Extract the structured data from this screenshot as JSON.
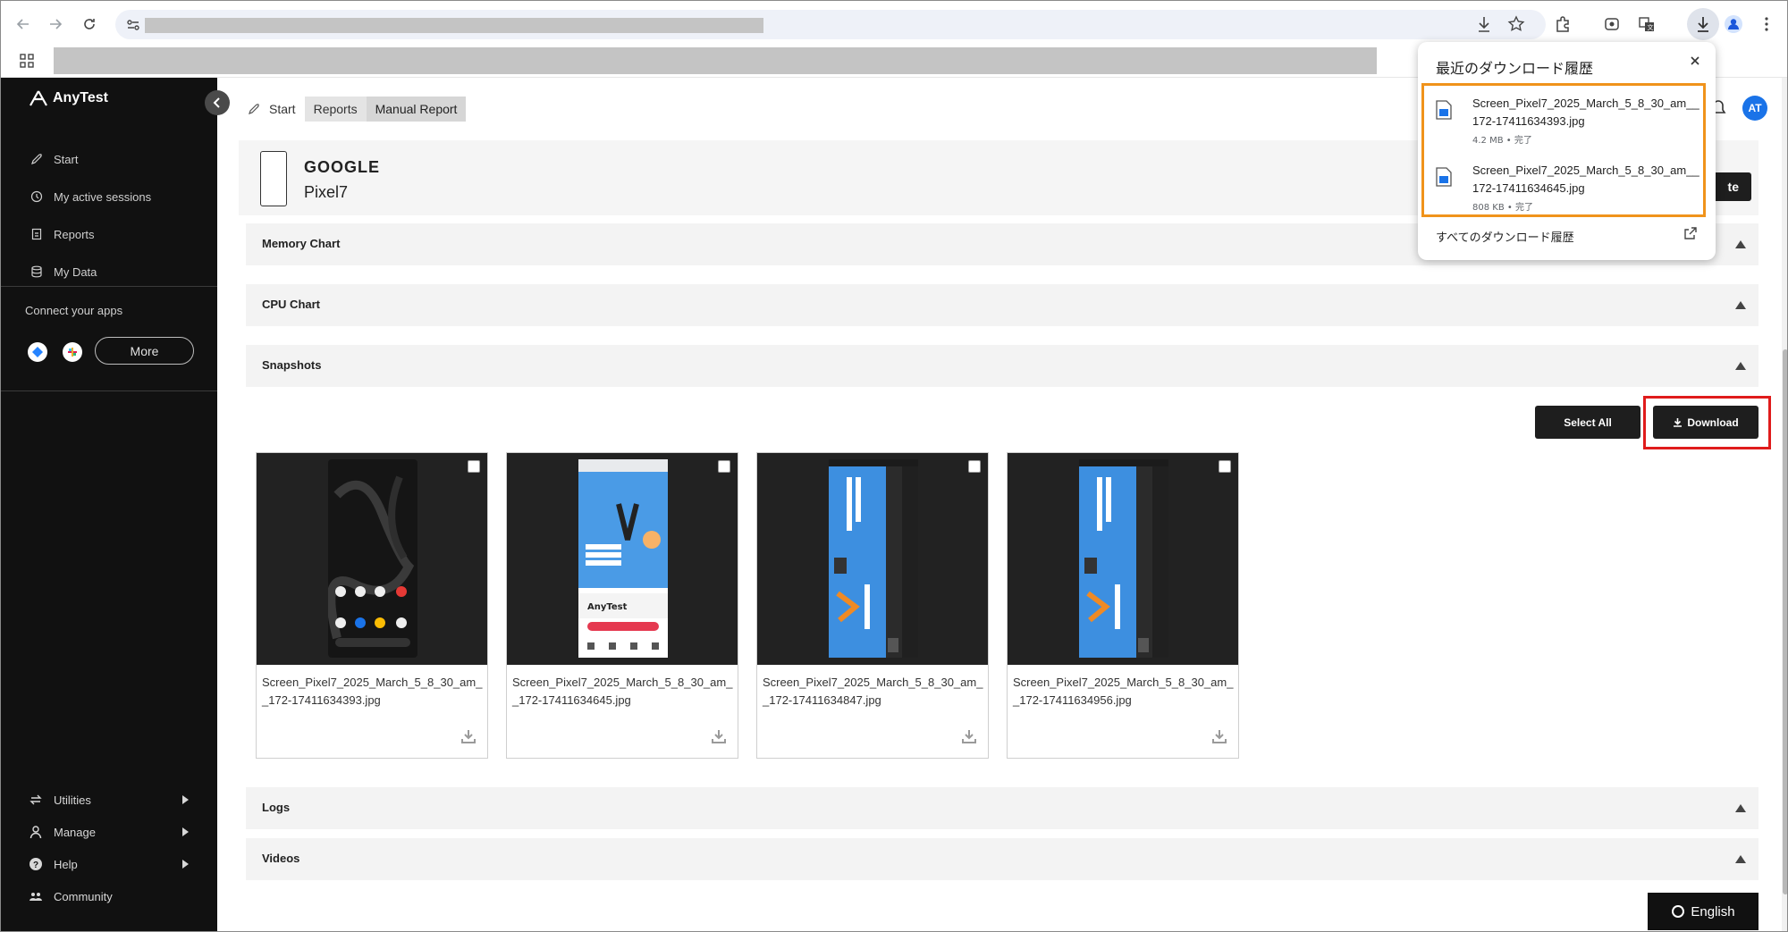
{
  "browser": {
    "icons": [
      "back-icon",
      "forward-icon",
      "reload-icon",
      "site-settings-icon",
      "download-icon",
      "star-icon",
      "extensions-icon",
      "screenshot-icon",
      "translate-icon",
      "downloads-icon",
      "profile-icon",
      "more-icon",
      "apps-icon"
    ]
  },
  "sidebar": {
    "brand": "AnyTest",
    "nav": [
      {
        "label": "Start",
        "icon": "rocket-icon"
      },
      {
        "label": "My active sessions",
        "icon": "clock-icon"
      },
      {
        "label": "Reports",
        "icon": "report-icon"
      },
      {
        "label": "My Data",
        "icon": "database-icon"
      }
    ],
    "connect_label": "Connect your apps",
    "more_label": "More",
    "bottom": [
      {
        "label": "Utilities",
        "icon": "utilities-icon"
      },
      {
        "label": "Manage",
        "icon": "person-icon"
      },
      {
        "label": "Help",
        "icon": "help-icon"
      },
      {
        "label": "Community",
        "icon": "community-icon"
      }
    ]
  },
  "breadcrumb": [
    "Start",
    "Reports",
    "Manual Report"
  ],
  "user": {
    "initials": "AT"
  },
  "device": {
    "brand": "GOOGLE",
    "model": "Pixel7"
  },
  "partial_button": "te",
  "sections": {
    "memory": "Memory Chart",
    "cpu": "CPU Chart",
    "snapshots": "Snapshots",
    "logs": "Logs",
    "videos": "Videos"
  },
  "actions": {
    "select_all": "Select All",
    "download": "Download"
  },
  "snapshots": [
    {
      "filename": "Screen_Pixel7_2025_March_5_8_30_am__172-17411634393.jpg"
    },
    {
      "filename": "Screen_Pixel7_2025_March_5_8_30_am__172-17411634645.jpg"
    },
    {
      "filename": "Screen_Pixel7_2025_March_5_8_30_am__172-17411634847.jpg"
    },
    {
      "filename": "Screen_Pixel7_2025_March_5_8_30_am__172-17411634956.jpg"
    }
  ],
  "language": "English",
  "downloads_popup": {
    "title": "最近のダウンロード履歴",
    "items": [
      {
        "filename": "Screen_Pixel7_2025_March_5_8_30_am__172-17411634393.jpg",
        "meta": "4.2 MB • 完了"
      },
      {
        "filename": "Screen_Pixel7_2025_March_5_8_30_am__172-17411634645.jpg",
        "meta": "808 KB • 完了"
      }
    ],
    "all_link": "すべてのダウンロード履歴"
  },
  "colors": {
    "accent_blue": "#1a73e8",
    "highlight_red": "#e01b1b",
    "highlight_orange": "#f0931b",
    "sidebar": "#111111"
  }
}
